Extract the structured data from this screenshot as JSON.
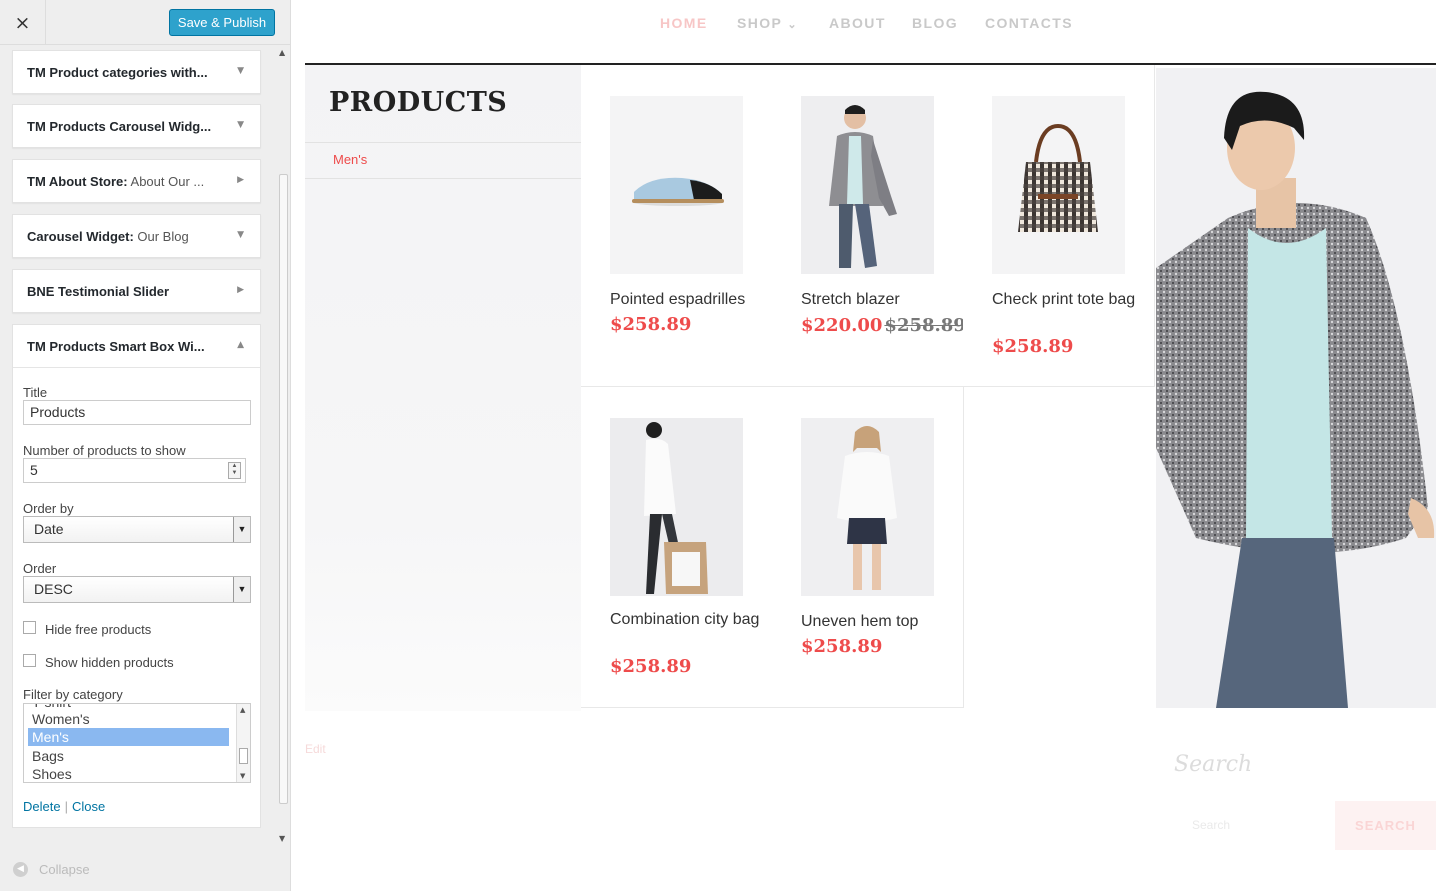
{
  "customizer": {
    "close_label": "×",
    "publish_label": "Save & Publish",
    "widgets": [
      {
        "title": "TM Product categories with...",
        "subtitle": "",
        "arrow": "▼"
      },
      {
        "title": "TM Products Carousel Widg...",
        "subtitle": "",
        "arrow": "▼"
      },
      {
        "title": "TM About Store:",
        "subtitle": " About Our ...",
        "arrow": "▶"
      },
      {
        "title": "Carousel Widget:",
        "subtitle": " Our Blog",
        "arrow": "▼"
      },
      {
        "title": "BNE Testimonial Slider",
        "subtitle": "",
        "arrow": "▶"
      }
    ],
    "open_widget": {
      "title": "TM Products Smart Box Wi...",
      "arrow": "▲",
      "title_label": "Title",
      "title_value": "Products",
      "count_label": "Number of products to show",
      "count_value": "5",
      "orderby_label": "Order by",
      "orderby_value": "Date",
      "order_label": "Order",
      "order_value": "DESC",
      "hide_free_label": "Hide free products",
      "show_hidden_label": "Show hidden products",
      "filter_label": "Filter by category",
      "categories": [
        "T-shirt",
        "Women's",
        "Men's",
        "Bags",
        "Shoes"
      ],
      "selected_category": "Men's",
      "delete_label": "Delete",
      "separator": "|",
      "close_label": "Close"
    },
    "collapse_label": "Collapse"
  },
  "site": {
    "nav": [
      "HOME",
      "SHOP",
      "ABOUT",
      "BLOG",
      "CONTACTS"
    ],
    "nav_active": "HOME",
    "shop_caret": "⌄",
    "section_title": "PRODUCTS",
    "category_link": "Men's",
    "products": [
      {
        "name": "Pointed espadrilles",
        "price": "$258.89",
        "old_price": ""
      },
      {
        "name": "Stretch blazer",
        "price": "$220.00",
        "old_price": "$258.89"
      },
      {
        "name": "Check print tote bag",
        "price": "$258.89",
        "old_price": ""
      },
      {
        "name": "Combination city bag",
        "price": "$258.89",
        "old_price": ""
      },
      {
        "name": "Uneven hem top",
        "price": "$258.89",
        "old_price": ""
      }
    ],
    "edit_label": "Edit",
    "search_title": "Search",
    "search_placeholder": "Search",
    "search_button": "SEARCH"
  },
  "colors": {
    "publish_button": "#2ea2cc",
    "accent_red": "#ee4b4b",
    "link_blue": "#0074a2",
    "selected_row": "#8ab8f0"
  }
}
